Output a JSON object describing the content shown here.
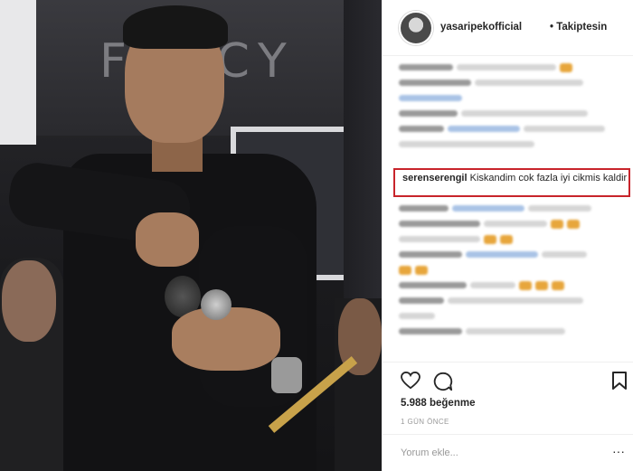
{
  "post": {
    "username": "yasaripekofficial",
    "follow_status": "• Takiptesin",
    "highlighted_comment": {
      "username": "serenserengil",
      "text": "Kiskandim cok fazla iyi cikmis kaldir"
    },
    "likes": "5.988 beğenme",
    "time": "1 GÜN ÖNCE",
    "comment_placeholder": "Yorum ekle...",
    "more": "···"
  },
  "photo": {
    "backdrop_text": "FANCY"
  },
  "colors": {
    "highlight_border": "#c8242b",
    "text": "#262626",
    "muted": "#999999"
  },
  "icons": [
    "heart-icon",
    "comment-icon",
    "bookmark-icon",
    "more-icon"
  ]
}
